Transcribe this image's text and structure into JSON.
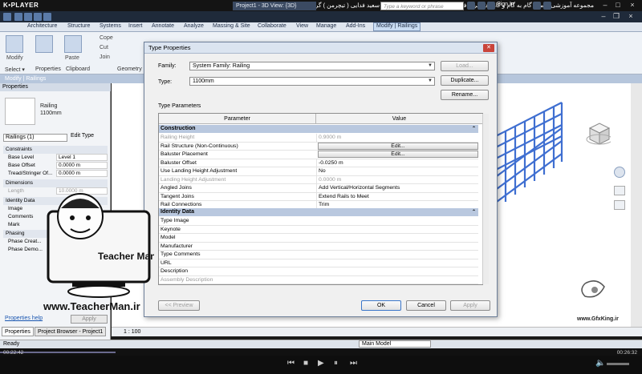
{
  "player": {
    "logo": "K•PLAYER",
    "title": "مجموعه آموزشی جامع ، گام به گام و کاربردی نرم افزار رویت آرکیتکچر ۲۰۱۶   مدرس : سعید فدایی ( تیچرمن ) گروه آموزشی پادشاه گرافیست ها",
    "time_current": "00:22:42",
    "time_total": "00:26:32",
    "progress": 0.18
  },
  "revit": {
    "project_tab": "Project1 - 3D View: {3D}",
    "search_placeholder": "Type a keyword or phrase",
    "sign_in": "Sign In",
    "tabs": [
      "Architecture",
      "Structure",
      "Systems",
      "Insert",
      "Annotate",
      "Analyze",
      "Massing & Site",
      "Collaborate",
      "View",
      "Manage",
      "Add-Ins",
      "Modify | Railings"
    ],
    "ribbon": {
      "modify": "Modify",
      "select": "Select ▾",
      "properties": "Properties",
      "clipboard": "Clipboard",
      "geometry": "Geometry",
      "paste": "Paste",
      "cope": "Cope",
      "cut": "Cut",
      "join": "Join"
    },
    "context_label": "Modify | Railings",
    "status_ready": "Ready",
    "scale": "1 : 100",
    "main_model": "Main Model"
  },
  "properties": {
    "header": "Properties",
    "type_name_1": "Railing",
    "type_name_2": "1100mm",
    "filter": "Railings (1)",
    "edit_type": "Edit Type",
    "groups": {
      "constraints": "Constraints",
      "dimensions": "Dimensions",
      "identity": "Identity Data",
      "phasing": "Phasing"
    },
    "rows": {
      "base_level": {
        "k": "Base Level",
        "v": "Level 1"
      },
      "base_offset": {
        "k": "Base Offset",
        "v": "0.0000 m"
      },
      "tread_offset": {
        "k": "Tread/Stringer Of...",
        "v": "0.0000 m"
      },
      "length": {
        "k": "Length",
        "v": "10.0000 m"
      },
      "image": {
        "k": "Image",
        "v": ""
      },
      "comments": {
        "k": "Comments",
        "v": ""
      },
      "mark": {
        "k": "Mark",
        "v": ""
      },
      "phase_created": {
        "k": "Phase Creat...",
        "v": ""
      },
      "phase_demolished": {
        "k": "Phase Demo...",
        "v": ""
      }
    },
    "help": "Properties help",
    "apply": "Apply",
    "tab_properties": "Properties",
    "tab_browser": "Project Browser - Project1"
  },
  "dialog": {
    "title": "Type Properties",
    "family_label": "Family:",
    "family_value": "System Family: Railing",
    "type_label": "Type:",
    "type_value": "1100mm",
    "load": "Load...",
    "duplicate": "Duplicate...",
    "rename": "Rename...",
    "type_params": "Type Parameters",
    "col_param": "Parameter",
    "col_value": "Value",
    "group_construction": "Construction",
    "group_identity": "Identity Data",
    "construction_rows": [
      {
        "p": "Railing Height",
        "v": "0.9000 m",
        "ro": true
      },
      {
        "p": "Rail Structure (Non-Continuous)",
        "v": "Edit...",
        "btn": true
      },
      {
        "p": "Baluster Placement",
        "v": "Edit...",
        "btn": true
      },
      {
        "p": "Baluster Offset",
        "v": "-0.0250 m"
      },
      {
        "p": "Use Landing Height Adjustment",
        "v": "No"
      },
      {
        "p": "Landing Height Adjustment",
        "v": "0.0000 m",
        "ro": true
      },
      {
        "p": "Angled Joins",
        "v": "Add Vertical/Horizontal Segments"
      },
      {
        "p": "Tangent Joins",
        "v": "Extend Rails to Meet"
      },
      {
        "p": "Rail Connections",
        "v": "Trim"
      }
    ],
    "identity_rows": [
      {
        "p": "Type Image",
        "v": ""
      },
      {
        "p": "Keynote",
        "v": ""
      },
      {
        "p": "Model",
        "v": ""
      },
      {
        "p": "Manufacturer",
        "v": ""
      },
      {
        "p": "Type Comments",
        "v": ""
      },
      {
        "p": "URL",
        "v": ""
      },
      {
        "p": "Description",
        "v": ""
      },
      {
        "p": "Assembly Description",
        "v": "",
        "ro": true
      }
    ],
    "preview": "<< Preview",
    "ok": "OK",
    "cancel": "Cancel",
    "apply": "Apply"
  },
  "overlays": {
    "site_url": "www.TeacherMan.ir",
    "gfx_url": "www.GfxKing.ir"
  },
  "colors": {
    "railing_blue": "#3f6fd1",
    "accent": "#3a76c9"
  }
}
